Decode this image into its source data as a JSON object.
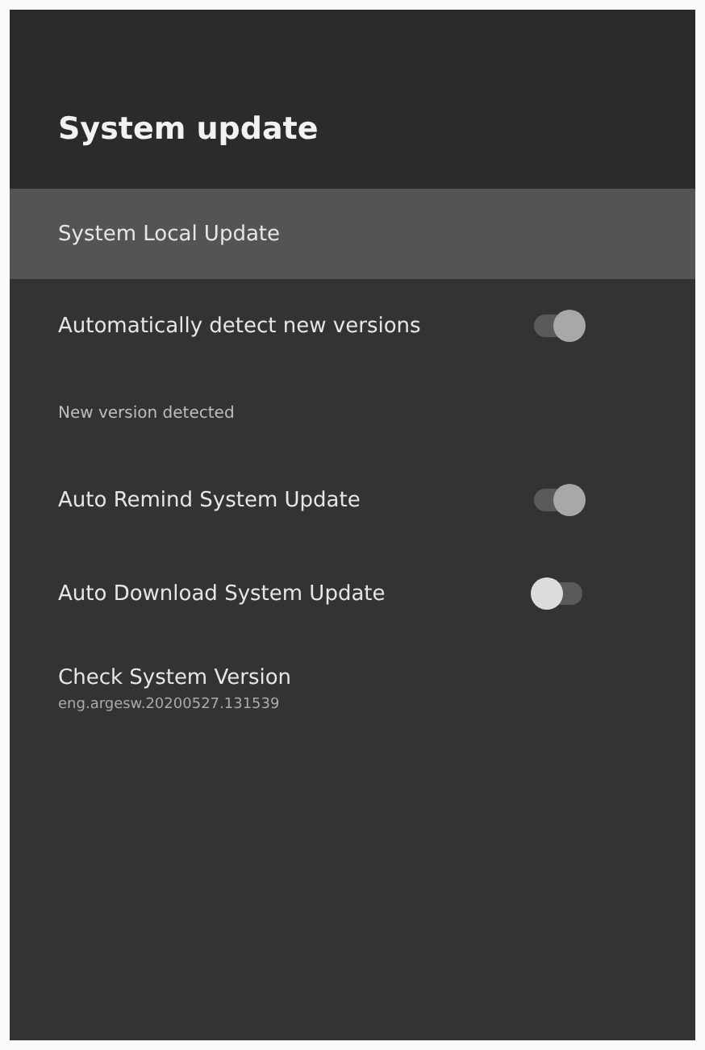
{
  "title": "System update",
  "items": [
    {
      "kind": "action",
      "label": "System Local Update",
      "selected": true
    },
    {
      "kind": "toggle",
      "label": "Automatically detect new versions",
      "selected": false,
      "on": true
    },
    {
      "kind": "caption",
      "label": "New version detected"
    },
    {
      "kind": "toggle",
      "label": "Auto Remind System Update",
      "selected": false,
      "on": true
    },
    {
      "kind": "toggle",
      "label": "Auto Download System Update",
      "selected": false,
      "on": false
    },
    {
      "kind": "info",
      "label": "Check System Version",
      "value": "eng.argesw.20200527.131539",
      "selected": false
    }
  ]
}
